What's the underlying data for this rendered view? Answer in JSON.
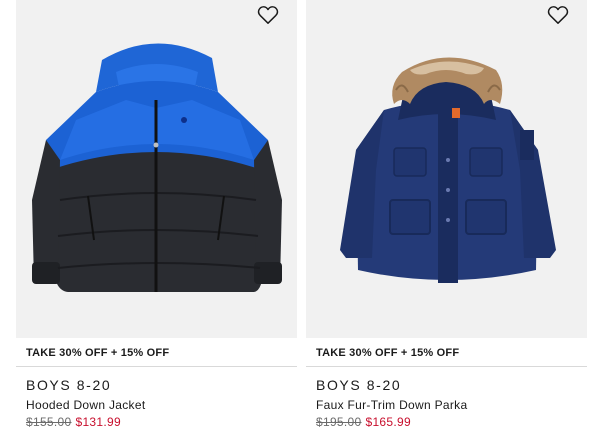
{
  "products": [
    {
      "promo": "TAKE 30% OFF + 15% OFF",
      "category": "BOYS 8-20",
      "name": "Hooded Down Jacket",
      "original_price": "$155.00",
      "sale_price": "$131.99",
      "image_icon": "hooded-down-jacket-image",
      "wishlist_icon": "heart-icon"
    },
    {
      "promo": "TAKE 30% OFF + 15% OFF",
      "category": "BOYS 8-20",
      "name": "Faux Fur-Trim Down Parka",
      "original_price": "$195.00",
      "sale_price": "$165.99",
      "image_icon": "faux-fur-parka-image",
      "wishlist_icon": "heart-icon"
    }
  ],
  "colors": {
    "sale_price": "#c8102e",
    "original_price": "#6b6b6b",
    "image_background": "#f1f1f1"
  }
}
